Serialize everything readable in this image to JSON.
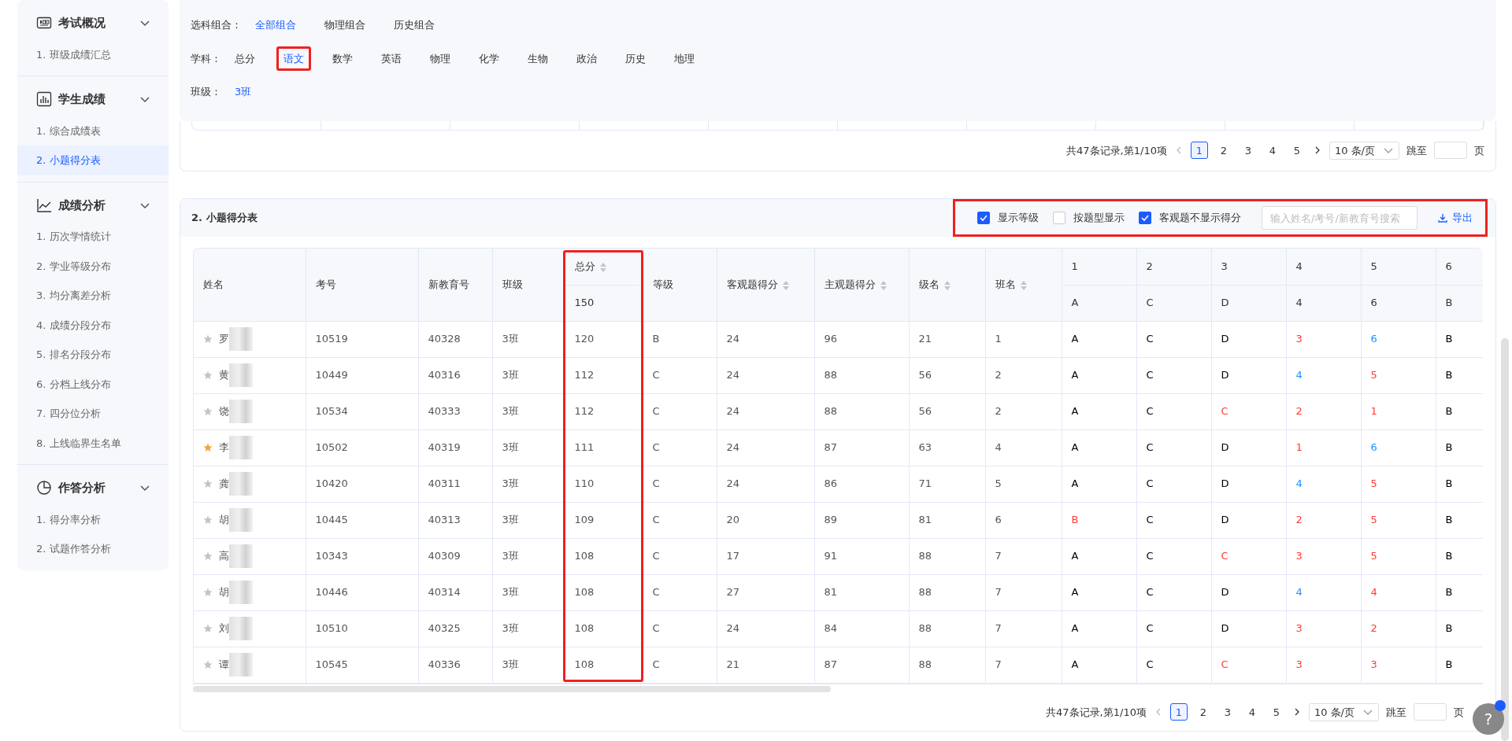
{
  "sidebar": [
    {
      "title": "考试概况",
      "expanded": true,
      "items": [
        {
          "label": "1. 班级成绩汇总",
          "selected": false
        }
      ]
    },
    {
      "title": "学生成绩",
      "expanded": true,
      "items": [
        {
          "label": "1. 综合成绩表",
          "selected": false
        },
        {
          "label": "2. 小题得分表",
          "selected": true
        }
      ]
    },
    {
      "title": "成绩分析",
      "expanded": true,
      "items": [
        {
          "label": "1. 历次学情统计",
          "selected": false
        },
        {
          "label": "2. 学业等级分布",
          "selected": false
        },
        {
          "label": "3. 均分离差分析",
          "selected": false
        },
        {
          "label": "4. 成绩分段分布",
          "selected": false
        },
        {
          "label": "5. 排名分段分布",
          "selected": false
        },
        {
          "label": "6. 分档上线分布",
          "selected": false
        },
        {
          "label": "7. 四分位分析",
          "selected": false
        },
        {
          "label": "8. 上线临界生名单",
          "selected": false
        }
      ]
    },
    {
      "title": "作答分析",
      "expanded": true,
      "items": [
        {
          "label": "1. 得分率分析",
          "selected": false
        },
        {
          "label": "2. 试题作答分析",
          "selected": false
        }
      ]
    }
  ],
  "filters": [
    {
      "label": "选科组合：",
      "options": [
        {
          "label": "全部组合",
          "selected": true,
          "highlighted": false
        },
        {
          "label": "物理组合",
          "selected": false,
          "highlighted": false
        },
        {
          "label": "历史组合",
          "selected": false,
          "highlighted": false
        }
      ]
    },
    {
      "label": "学科：",
      "options": [
        {
          "label": "总分",
          "selected": false,
          "highlighted": false
        },
        {
          "label": "语文",
          "selected": true,
          "highlighted": true
        },
        {
          "label": "数学",
          "selected": false,
          "highlighted": false
        },
        {
          "label": "英语",
          "selected": false,
          "highlighted": false
        },
        {
          "label": "物理",
          "selected": false,
          "highlighted": false
        },
        {
          "label": "化学",
          "selected": false,
          "highlighted": false
        },
        {
          "label": "生物",
          "selected": false,
          "highlighted": false
        },
        {
          "label": "政治",
          "selected": false,
          "highlighted": false
        },
        {
          "label": "历史",
          "selected": false,
          "highlighted": false
        },
        {
          "label": "地理",
          "selected": false,
          "highlighted": false
        }
      ]
    },
    {
      "label": "班级：",
      "options": [
        {
          "label": "3班",
          "selected": true,
          "highlighted": false
        }
      ]
    }
  ],
  "top_pagination": {
    "summary": "共47条记录,第1/10项",
    "pages": [
      {
        "label": "1",
        "selected": true
      },
      {
        "label": "2",
        "selected": false
      },
      {
        "label": "3",
        "selected": false
      },
      {
        "label": "4",
        "selected": false
      },
      {
        "label": "5",
        "selected": false
      }
    ],
    "page_size": "10 条/页",
    "jump_label": "跳至",
    "page_unit": "页"
  },
  "section": {
    "title": "2. 小题得分表",
    "toolbar": {
      "highlighted": true,
      "options": [
        {
          "label": "显示等级",
          "checked": true
        },
        {
          "label": "按题型显示",
          "checked": false
        },
        {
          "label": "客观题不显示得分",
          "checked": true
        }
      ],
      "search_placeholder": "输入姓名/考号/新教育号搜索",
      "export": "导出"
    },
    "table": {
      "columns": [
        {
          "label": "姓名",
          "sortable": false,
          "highlighted": false
        },
        {
          "label": "考号",
          "sortable": false,
          "highlighted": false
        },
        {
          "label": "新教育号",
          "sortable": false,
          "highlighted": false
        },
        {
          "label": "班级",
          "sortable": false,
          "highlighted": false
        },
        {
          "label": "总分",
          "sortable": true,
          "highlighted": true,
          "full_score": "150"
        },
        {
          "label": "等级",
          "sortable": false,
          "highlighted": false
        },
        {
          "label": "客观题得分",
          "sortable": true,
          "highlighted": false
        },
        {
          "label": "主观题得分",
          "sortable": true,
          "highlighted": false
        },
        {
          "label": "级名",
          "sortable": true,
          "highlighted": false
        },
        {
          "label": "班名",
          "sortable": true,
          "highlighted": false
        }
      ],
      "questions": [
        {
          "number": "1",
          "answer": "A"
        },
        {
          "number": "2",
          "answer": "C"
        },
        {
          "number": "3",
          "answer": "D"
        },
        {
          "number": "4",
          "answer": "4"
        },
        {
          "number": "5",
          "answer": "6"
        },
        {
          "number": "6",
          "answer": "B"
        }
      ],
      "rows": [
        {
          "starred": false,
          "cells": [
            "罗",
            "10519",
            "40328",
            "3班",
            "120",
            "B",
            "24",
            "96",
            "21",
            "1"
          ],
          "answers": [
            {
              "text": "A",
              "color": "#000000"
            },
            {
              "text": "C",
              "color": "#000000"
            },
            {
              "text": "D",
              "color": "#000000"
            },
            {
              "text": "3",
              "color": "#ff3b30"
            },
            {
              "text": "6",
              "color": "#1e90ff"
            },
            {
              "text": "B",
              "color": "#000000"
            }
          ]
        },
        {
          "starred": false,
          "cells": [
            "黄",
            "10449",
            "40316",
            "3班",
            "112",
            "C",
            "24",
            "88",
            "56",
            "2"
          ],
          "answers": [
            {
              "text": "A",
              "color": "#000000"
            },
            {
              "text": "C",
              "color": "#000000"
            },
            {
              "text": "D",
              "color": "#000000"
            },
            {
              "text": "4",
              "color": "#1e90ff"
            },
            {
              "text": "5",
              "color": "#ff3b30"
            },
            {
              "text": "B",
              "color": "#000000"
            }
          ]
        },
        {
          "starred": false,
          "cells": [
            "饶",
            "10534",
            "40333",
            "3班",
            "112",
            "C",
            "24",
            "88",
            "56",
            "2"
          ],
          "answers": [
            {
              "text": "A",
              "color": "#000000"
            },
            {
              "text": "C",
              "color": "#000000"
            },
            {
              "text": "C",
              "color": "#ff3b30"
            },
            {
              "text": "2",
              "color": "#ff3b30"
            },
            {
              "text": "1",
              "color": "#ff3b30"
            },
            {
              "text": "B",
              "color": "#000000"
            }
          ]
        },
        {
          "starred": true,
          "cells": [
            "李",
            "10502",
            "40319",
            "3班",
            "111",
            "C",
            "24",
            "87",
            "63",
            "4"
          ],
          "answers": [
            {
              "text": "A",
              "color": "#000000"
            },
            {
              "text": "C",
              "color": "#000000"
            },
            {
              "text": "D",
              "color": "#000000"
            },
            {
              "text": "1",
              "color": "#ff3b30"
            },
            {
              "text": "6",
              "color": "#1e90ff"
            },
            {
              "text": "B",
              "color": "#000000"
            }
          ]
        },
        {
          "starred": false,
          "cells": [
            "龚",
            "10420",
            "40311",
            "3班",
            "110",
            "C",
            "24",
            "86",
            "71",
            "5"
          ],
          "answers": [
            {
              "text": "A",
              "color": "#000000"
            },
            {
              "text": "C",
              "color": "#000000"
            },
            {
              "text": "D",
              "color": "#000000"
            },
            {
              "text": "4",
              "color": "#1e90ff"
            },
            {
              "text": "5",
              "color": "#ff3b30"
            },
            {
              "text": "B",
              "color": "#000000"
            }
          ]
        },
        {
          "starred": false,
          "cells": [
            "胡",
            "10445",
            "40313",
            "3班",
            "109",
            "C",
            "20",
            "89",
            "81",
            "6"
          ],
          "answers": [
            {
              "text": "B",
              "color": "#ff3b30"
            },
            {
              "text": "C",
              "color": "#000000"
            },
            {
              "text": "D",
              "color": "#000000"
            },
            {
              "text": "2",
              "color": "#ff3b30"
            },
            {
              "text": "5",
              "color": "#ff3b30"
            },
            {
              "text": "B",
              "color": "#000000"
            }
          ]
        },
        {
          "starred": false,
          "cells": [
            "高",
            "10343",
            "40309",
            "3班",
            "108",
            "C",
            "17",
            "91",
            "88",
            "7"
          ],
          "answers": [
            {
              "text": "A",
              "color": "#000000"
            },
            {
              "text": "C",
              "color": "#000000"
            },
            {
              "text": "C",
              "color": "#ff3b30"
            },
            {
              "text": "3",
              "color": "#ff3b30"
            },
            {
              "text": "5",
              "color": "#ff3b30"
            },
            {
              "text": "B",
              "color": "#000000"
            }
          ]
        },
        {
          "starred": false,
          "cells": [
            "胡",
            "10446",
            "40314",
            "3班",
            "108",
            "C",
            "27",
            "81",
            "88",
            "7"
          ],
          "answers": [
            {
              "text": "A",
              "color": "#000000"
            },
            {
              "text": "C",
              "color": "#000000"
            },
            {
              "text": "D",
              "color": "#000000"
            },
            {
              "text": "4",
              "color": "#1e90ff"
            },
            {
              "text": "4",
              "color": "#ff3b30"
            },
            {
              "text": "B",
              "color": "#000000"
            }
          ]
        },
        {
          "starred": false,
          "cells": [
            "刘",
            "10510",
            "40325",
            "3班",
            "108",
            "C",
            "24",
            "84",
            "88",
            "7"
          ],
          "answers": [
            {
              "text": "A",
              "color": "#000000"
            },
            {
              "text": "C",
              "color": "#000000"
            },
            {
              "text": "D",
              "color": "#000000"
            },
            {
              "text": "3",
              "color": "#ff3b30"
            },
            {
              "text": "2",
              "color": "#ff3b30"
            },
            {
              "text": "B",
              "color": "#000000"
            }
          ]
        },
        {
          "starred": false,
          "cells": [
            "谭",
            "10545",
            "40336",
            "3班",
            "108",
            "C",
            "21",
            "87",
            "88",
            "7"
          ],
          "answers": [
            {
              "text": "A",
              "color": "#000000"
            },
            {
              "text": "C",
              "color": "#000000"
            },
            {
              "text": "C",
              "color": "#ff3b30"
            },
            {
              "text": "3",
              "color": "#ff3b30"
            },
            {
              "text": "3",
              "color": "#ff3b30"
            },
            {
              "text": "B",
              "color": "#000000"
            }
          ]
        }
      ]
    }
  },
  "bottom_pagination": {
    "summary": "共47条记录,第1/10项",
    "pages": [
      {
        "label": "1",
        "selected": true
      },
      {
        "label": "2",
        "selected": false
      },
      {
        "label": "3",
        "selected": false
      },
      {
        "label": "4",
        "selected": false
      },
      {
        "label": "5",
        "selected": false
      }
    ],
    "page_size": "10 条/页",
    "jump_label": "跳至",
    "page_unit": "页"
  },
  "help_button": "?"
}
